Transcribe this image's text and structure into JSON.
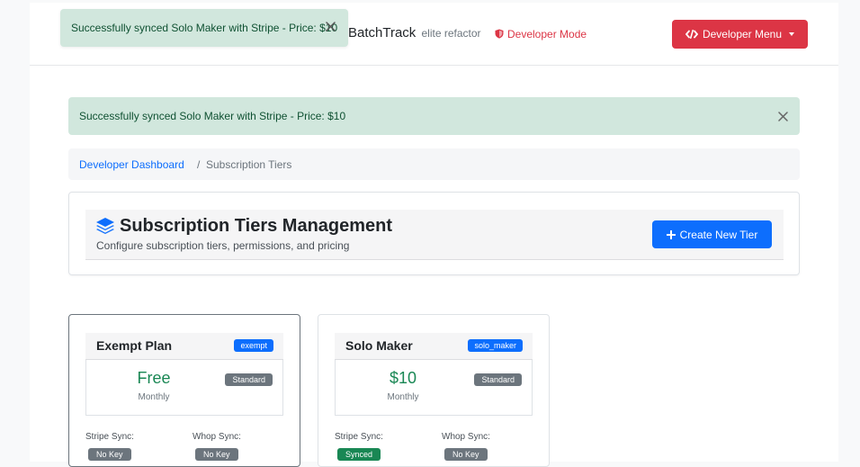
{
  "navbar": {
    "brand": "BatchTrack",
    "brand_sub": "elite refactor",
    "dev_mode": "Developer Mode",
    "dev_menu_label": "Developer Menu"
  },
  "toast": {
    "message": "Successfully synced Solo Maker with Stripe - Price: $10"
  },
  "alert": {
    "message": "Successfully synced Solo Maker with Stripe - Price: $10"
  },
  "breadcrumb": {
    "link": "Developer Dashboard",
    "separator": "/",
    "current": "Subscription Tiers"
  },
  "header": {
    "title": "Subscription Tiers Management",
    "subtitle": "Configure subscription tiers, permissions, and pricing",
    "create_label": "Create New Tier"
  },
  "tiers": [
    {
      "name": "Exempt Plan",
      "key": "exempt",
      "price": "Free",
      "period": "Monthly",
      "type": "Standard",
      "stripe_label": "Stripe Sync:",
      "stripe_status": "No Key",
      "whop_label": "Whop Sync:",
      "whop_status": "No Key"
    },
    {
      "name": "Solo Maker",
      "key": "solo_maker",
      "price": "$10",
      "period": "Monthly",
      "type": "Standard",
      "stripe_label": "Stripe Sync:",
      "stripe_status": "Synced",
      "whop_label": "Whop Sync:",
      "whop_status": "No Key"
    }
  ],
  "colors": {
    "primary": "#0d6efd",
    "danger": "#dc3545",
    "success": "#198754",
    "alert_bg": "#d1e7dd",
    "secondary": "#6c757d"
  },
  "icons": [
    "shield-icon",
    "code-icon",
    "close-icon",
    "layers-icon",
    "plus-icon",
    "caret-down-icon"
  ]
}
